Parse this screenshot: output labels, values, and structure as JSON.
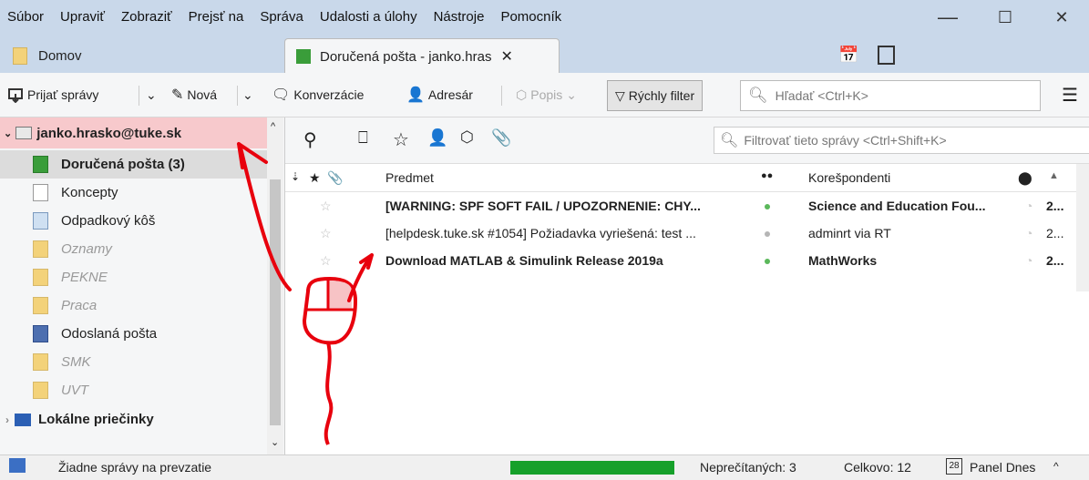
{
  "menu": [
    "Súbor",
    "Upraviť",
    "Zobraziť",
    "Prejsť na",
    "Správa",
    "Udalosti a úlohy",
    "Nástroje",
    "Pomocník"
  ],
  "window_controls": {
    "minimize": "—",
    "maximize": "☐",
    "close": "✕"
  },
  "tabs": {
    "home": "Domov",
    "inbox": "Doručená pošta - janko.hras"
  },
  "toolbar": {
    "get_messages": "Prijať správy",
    "new": "Nová",
    "chat": "Konverzácie",
    "address_book": "Adresár",
    "tag": "Popis",
    "quick_filter": "Rýchly filter",
    "search_placeholder": "Hľadať <Ctrl+K>"
  },
  "sidebar": {
    "account": "janko.hrasko@tuke.sk",
    "folders": [
      {
        "label": "Doručená pošta (3)",
        "icon": "inbox-icon"
      },
      {
        "label": "Koncepty",
        "icon": "drafts-icon"
      },
      {
        "label": "Odpadkový kôš",
        "icon": "trash-icon"
      },
      {
        "label": "Oznamy",
        "icon": "folder-icon"
      },
      {
        "label": "PEKNE",
        "icon": "folder-icon"
      },
      {
        "label": "Praca",
        "icon": "folder-icon"
      },
      {
        "label": "Odoslaná pošta",
        "icon": "sent-icon"
      },
      {
        "label": "SMK",
        "icon": "folder-icon"
      },
      {
        "label": "UVT",
        "icon": "folder-icon"
      }
    ],
    "local_folders": "Lokálne priečinky"
  },
  "filter": {
    "placeholder": "Filtrovať tieto správy <Ctrl+Shift+K>"
  },
  "columns": {
    "subject": "Predmet",
    "correspondents": "Korešpondenti"
  },
  "messages": [
    {
      "subject": "[WARNING: SPF SOFT FAIL / UPOZORNENIE: CHY...",
      "from": "Science and Education Fou...",
      "date": "2...",
      "unread": true
    },
    {
      "subject": "[helpdesk.tuke.sk #1054] Požiadavka vyriešená: test ...",
      "from": "adminrt via RT",
      "date": "2...",
      "unread": false
    },
    {
      "subject": "Download MATLAB & Simulink Release 2019a",
      "from": "MathWorks",
      "date": "2...",
      "unread": true
    }
  ],
  "status": {
    "message": "Žiadne správy na prevzatie",
    "progress": 1.0,
    "unread": "Neprečítaných: 3",
    "total": "Celkovo: 12",
    "today_pane": "Panel Dnes"
  },
  "colors": {
    "accent_bg": "#c9d8ea",
    "selected_account": "#f7c9cc",
    "annotation": "#e8000d",
    "progress": "#16a02a"
  }
}
